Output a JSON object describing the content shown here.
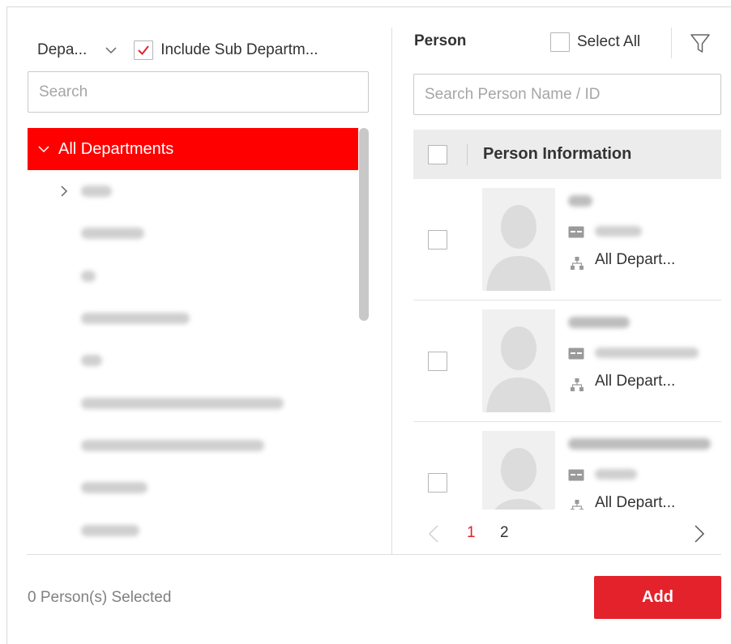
{
  "left": {
    "dept_select_label": "Depa...",
    "include_sub_label": "Include Sub Departm...",
    "include_sub_checked": true,
    "search_placeholder": "Search",
    "tree_root_label": "All Departments"
  },
  "right": {
    "title": "Person",
    "select_all_label": "Select All",
    "search_placeholder": "Search Person Name / ID",
    "column_header": "Person Information",
    "rows": [
      {
        "department": "All Depart..."
      },
      {
        "department": "All Depart..."
      },
      {
        "department": "All Depart..."
      }
    ],
    "pages": [
      "1",
      "2"
    ],
    "current_page": "1"
  },
  "footer": {
    "selected_text": "0 Person(s) Selected",
    "add_label": "Add"
  },
  "colors": {
    "accent": "#e3222b",
    "tree_selected": "#ff0000"
  },
  "icons": {
    "dept_chevron": "chevron-down-icon",
    "filter": "filter-icon",
    "id_card": "id-card-icon",
    "department": "org-chart-icon",
    "prev": "chevron-left-icon",
    "next": "chevron-right-icon"
  }
}
